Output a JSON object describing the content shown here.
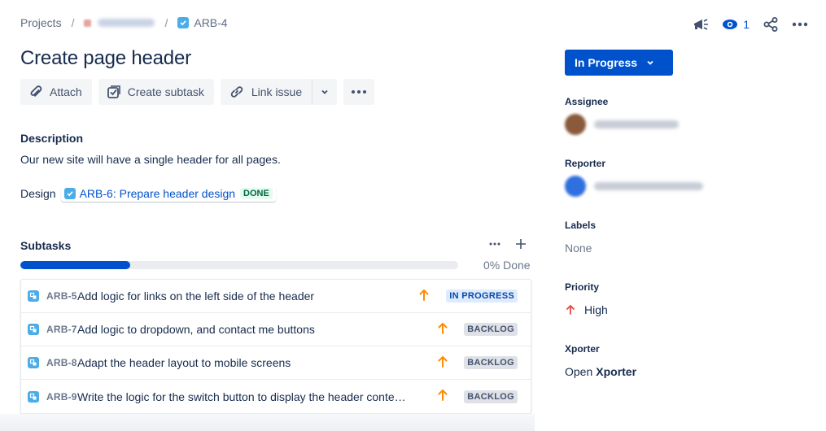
{
  "breadcrumb": {
    "projects": "Projects",
    "separator": "/",
    "project_icon": "project-avatar-icon",
    "issue_key": "ARB-4"
  },
  "header": {
    "watch_count": "1",
    "icons": [
      "feedback-megaphone-icon",
      "eye-watch-icon",
      "share-icon",
      "more-icon"
    ]
  },
  "issue": {
    "title": "Create page header"
  },
  "toolbar": {
    "attach": "Attach",
    "create_subtask": "Create subtask",
    "link_issue": "Link issue"
  },
  "description": {
    "heading": "Description",
    "text": "Our new site will have a single header for all pages.",
    "design_label": "Design",
    "design_link": "ARB-6: Prepare header design",
    "design_status": "DONE"
  },
  "subtasks": {
    "heading": "Subtasks",
    "progress_fraction": 0.25,
    "progress_text": "0% Done",
    "items": [
      {
        "key": "ARB-5",
        "summary": "Add logic for links on the left side of the header",
        "priority": "high",
        "status": "IN PROGRESS",
        "status_kind": "inprog"
      },
      {
        "key": "ARB-7",
        "summary": "Add logic to dropdown, and contact me buttons",
        "priority": "high",
        "status": "BACKLOG",
        "status_kind": "backlog"
      },
      {
        "key": "ARB-8",
        "summary": "Adapt the header layout to mobile screens",
        "priority": "high",
        "status": "BACKLOG",
        "status_kind": "backlog"
      },
      {
        "key": "ARB-9",
        "summary": "Write the logic for the switch button to display the header conte…",
        "priority": "high",
        "status": "BACKLOG",
        "status_kind": "backlog"
      }
    ]
  },
  "sidebar": {
    "status": "In Progress",
    "assignee_label": "Assignee",
    "reporter_label": "Reporter",
    "labels_label": "Labels",
    "labels_value": "None",
    "priority_label": "Priority",
    "priority_value": "High",
    "xporter_label": "Xporter",
    "xporter_prefix": "Open",
    "xporter_name": "Xporter"
  },
  "colors": {
    "primary": "#0052cc",
    "task_icon": "#4bade8",
    "priority_high": "#ff8b00",
    "priority_high_sidebar": "#e5493a"
  }
}
